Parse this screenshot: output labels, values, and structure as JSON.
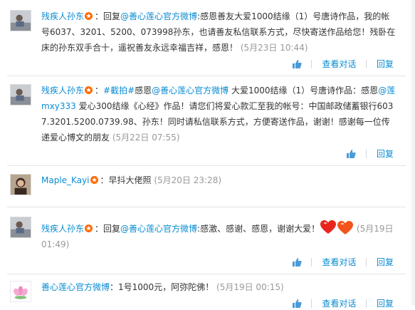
{
  "comments": [
    {
      "user": "残疾人孙东",
      "text_a": "：回复",
      "link1": "@善心莲心官方微博",
      "text_b": ":感恩善友大爱1000结缘（1）号唐诗作品，我的帐号6037、3201、5200、073998孙东，也请善友私信联系方式，尽快寄送作品给您！残卧在床的孙东双手合十，遥祝善友永远幸福吉祥，感恩！",
      "time": "(5月23日 10:44)",
      "view_label": "查看对话",
      "reply_label": "回复"
    },
    {
      "user": "残疾人孙东",
      "text_a": "：",
      "link1": "#截拍#",
      "text_b": "感恩",
      "link2": "@善心莲心官方微博",
      "text_c": " 大爱1000结缘（1）号唐诗作品：感恩",
      "link3": "@莲mxy333",
      "text_d": " 爱心300结缘《心经》作品！请您们将爱心款汇至我的帐号：中国邮政储蓄银行6037.3201.5200.0739.98、孙东！同时请私信联系方式，方便寄送作品，谢谢！感谢每一位传递爱心博文的朋友",
      "time": "(5月22日 07:55)",
      "reply_label": "回复"
    },
    {
      "user": "Maple_Kayi",
      "text_a": "：早抖大佬照",
      "time": "(5月20日 23:28)"
    },
    {
      "user": "残疾人孙东",
      "text_a": "：回复",
      "link1": "@善心莲心官方微博",
      "text_b": ":感激、感谢、感恩，谢谢大爱！",
      "time": "(5月19日 01:49)",
      "reply_label": "回复"
    },
    {
      "user": "善心莲心官方微博",
      "text_a": "：1号1000元，阿弥陀佛！",
      "time": "(5月19日 00:15)",
      "view_label": "查看对话",
      "reply_label": "回复"
    }
  ],
  "colors": {
    "link": "#0a8cd2",
    "time": "#999999",
    "badge": "#ff6a00",
    "heart": "#e8251c"
  },
  "icons": {
    "badge": "star-badge-icon",
    "like": "thumbs-up-icon",
    "emoji": "double-heart-icon"
  }
}
